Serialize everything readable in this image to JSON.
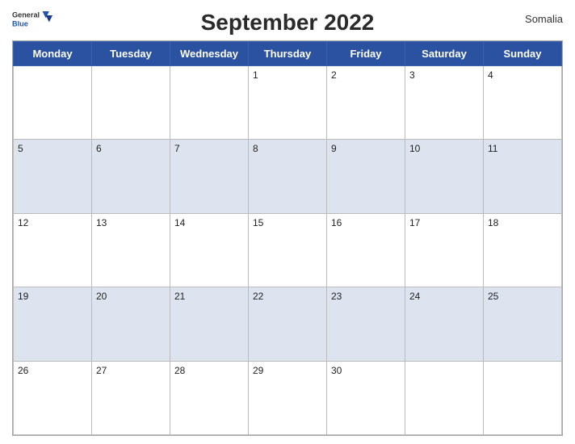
{
  "header": {
    "logo": {
      "general": "General",
      "blue": "Blue",
      "icon": "▲"
    },
    "title": "September 2022",
    "country": "Somalia"
  },
  "days_of_week": [
    "Monday",
    "Tuesday",
    "Wednesday",
    "Thursday",
    "Friday",
    "Saturday",
    "Sunday"
  ],
  "weeks": [
    [
      null,
      null,
      null,
      1,
      2,
      3,
      4
    ],
    [
      5,
      6,
      7,
      8,
      9,
      10,
      11
    ],
    [
      12,
      13,
      14,
      15,
      16,
      17,
      18
    ],
    [
      19,
      20,
      21,
      22,
      23,
      24,
      25
    ],
    [
      26,
      27,
      28,
      29,
      30,
      null,
      null
    ]
  ],
  "colors": {
    "header_bg": "#2a52a0",
    "odd_row_bg": "#dde4f0",
    "even_row_bg": "#ffffff"
  }
}
